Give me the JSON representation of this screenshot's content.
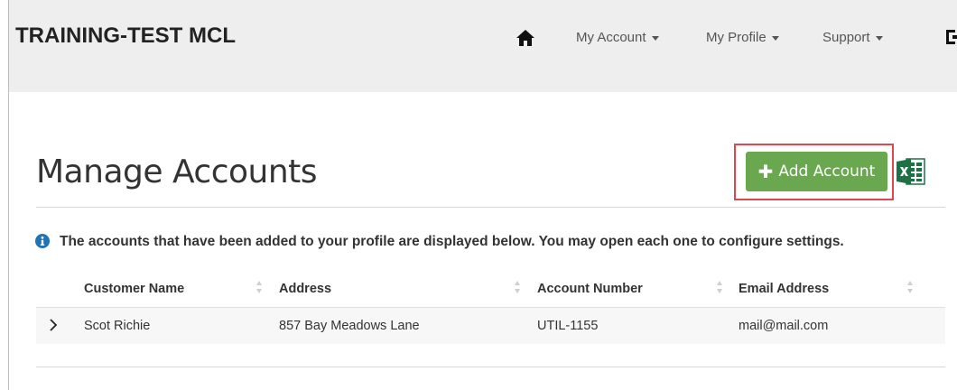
{
  "navbar": {
    "brand": "TRAINING-TEST MCL",
    "items": [
      {
        "label": "My Account"
      },
      {
        "label": "My Profile"
      },
      {
        "label": "Support"
      }
    ]
  },
  "page": {
    "title": "Manage Accounts",
    "add_button_label": "Add Account",
    "info_text": "The accounts that have been added to your profile are displayed below. You may open each one to configure settings."
  },
  "table": {
    "columns": [
      "Customer Name",
      "Address",
      "Account Number",
      "Email Address"
    ],
    "rows": [
      [
        "Scot Richie",
        "857 Bay Meadows Lane",
        "UTIL-1155",
        "mail@mail.com"
      ]
    ]
  },
  "colors": {
    "navbar_bg": "#eeeeee",
    "accent_green": "#6aa84f",
    "highlight_red": "#e0464e",
    "info_blue": "#1f73b7",
    "excel_green": "#1e7145"
  },
  "icons": [
    "home-icon",
    "sign-out-icon",
    "plus-icon",
    "excel-export-icon",
    "info-icon",
    "sort-icon",
    "chevron-right-icon"
  ]
}
